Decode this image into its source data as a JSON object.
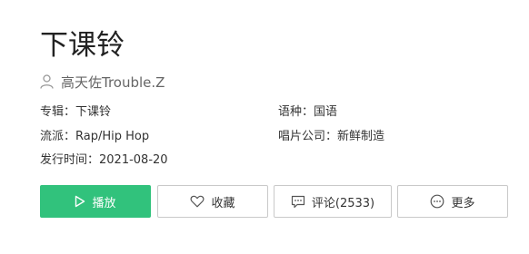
{
  "song": {
    "title": "下课铃",
    "artist": "高天佐Trouble.Z"
  },
  "meta": {
    "album_label": "专辑：",
    "album_value": "下课铃",
    "language_label": "语种：",
    "language_value": "国语",
    "genre_label": "流派：",
    "genre_value": "Rap/Hip Hop",
    "label_company_label": "唱片公司：",
    "label_company_value": "新鲜制造",
    "release_label": "发行时间：",
    "release_value": "2021-08-20"
  },
  "actions": {
    "play": "播放",
    "favorite": "收藏",
    "comment": "评论(2533)",
    "more": "更多"
  },
  "colors": {
    "accent": "#31c27c",
    "border": "#c9c9c9",
    "text": "#333333"
  },
  "icons": {
    "artist": "user-icon",
    "play": "play-icon",
    "favorite": "heart-icon",
    "comment": "comment-icon",
    "more": "more-dots-icon"
  }
}
